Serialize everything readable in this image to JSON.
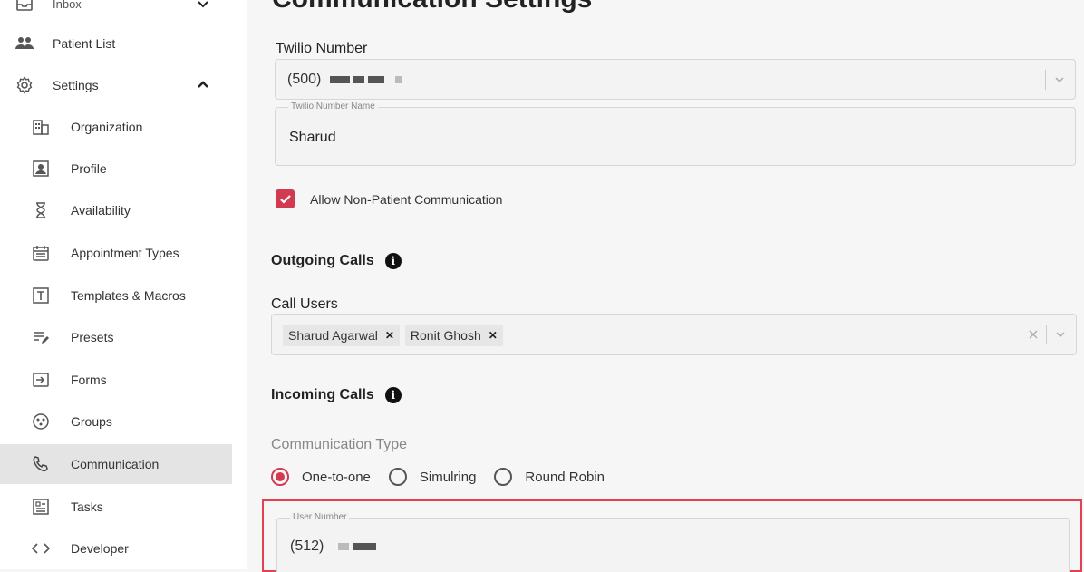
{
  "sidebar": {
    "items": [
      {
        "label": "Inbox"
      },
      {
        "label": "Patient List"
      },
      {
        "label": "Settings"
      },
      {
        "label": "Organization"
      },
      {
        "label": "Profile"
      },
      {
        "label": "Availability"
      },
      {
        "label": "Appointment Types"
      },
      {
        "label": "Templates & Macros"
      },
      {
        "label": "Presets"
      },
      {
        "label": "Forms"
      },
      {
        "label": "Groups"
      },
      {
        "label": "Communication"
      },
      {
        "label": "Tasks"
      },
      {
        "label": "Developer"
      }
    ]
  },
  "page": {
    "title": "Communication Settings"
  },
  "twilio": {
    "label": "Twilio Number",
    "number_prefix": "(500)",
    "name_legend": "Twilio Number Name",
    "name_value": "Sharud"
  },
  "allow_non_patient": {
    "label": "Allow Non-Patient Communication",
    "checked": true
  },
  "outgoing": {
    "title": "Outgoing Calls",
    "call_users_label": "Call Users",
    "chips": [
      "Sharud Agarwal",
      "Ronit Ghosh"
    ]
  },
  "incoming": {
    "title": "Incoming Calls",
    "type_label": "Communication Type",
    "options": [
      "One-to-one",
      "Simulring",
      "Round Robin"
    ],
    "user_number_legend": "User Number",
    "user_number_prefix": "(512)"
  },
  "colors": {
    "accent": "#d23b4f",
    "highlight_border": "#e0434f"
  }
}
